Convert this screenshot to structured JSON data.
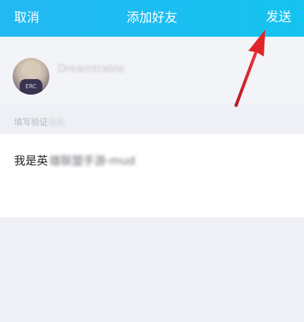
{
  "header": {
    "cancel_label": "取消",
    "title": "添加好友",
    "send_label": "发送"
  },
  "profile": {
    "nickname": "Dreamtrable",
    "avatar_text": "ERC"
  },
  "verify": {
    "label": "填写验证",
    "label_blurred": "信息"
  },
  "message": {
    "value_visible": "我是英",
    "value_blurred": "雄联盟手游-mud"
  },
  "colors": {
    "header_gradient_start": "#23b8f2",
    "header_gradient_end": "#14c3f0",
    "annotation_arrow": "#e0242a"
  },
  "icons": {
    "annotation": "red-arrow-icon"
  }
}
